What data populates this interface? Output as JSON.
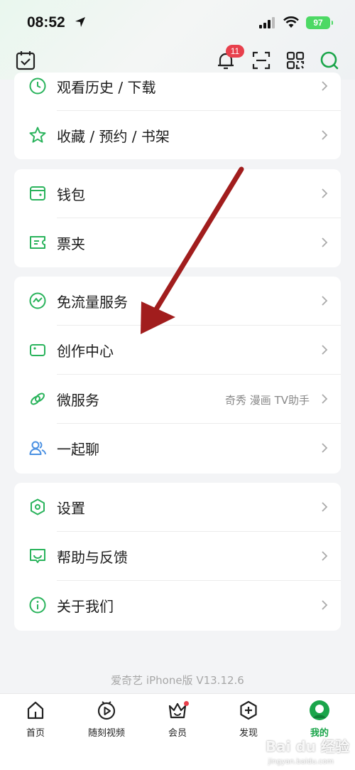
{
  "status_bar": {
    "time": "08:52",
    "battery": "97"
  },
  "header": {
    "notification_count": "11"
  },
  "group1": [
    {
      "label": "观看历史 / 下载"
    },
    {
      "label": "收藏 / 预约 / 书架"
    }
  ],
  "group2": [
    {
      "label": "钱包"
    },
    {
      "label": "票夹"
    }
  ],
  "group3": [
    {
      "label": "免流量服务"
    },
    {
      "label": "创作中心"
    },
    {
      "label": "微服务",
      "extra": "奇秀 漫画 TV助手"
    },
    {
      "label": "一起聊"
    }
  ],
  "group4": [
    {
      "label": "设置"
    },
    {
      "label": "帮助与反馈"
    },
    {
      "label": "关于我们"
    }
  ],
  "footer": {
    "version": "爱奇艺 iPhone版 V13.12.6"
  },
  "tabbar": [
    {
      "label": "首页"
    },
    {
      "label": "随刻视频"
    },
    {
      "label": "会员"
    },
    {
      "label": "发现"
    },
    {
      "label": "我的"
    }
  ],
  "watermark": {
    "text": "Bai du 经验",
    "sub": "jingyan.baidu.com"
  },
  "colors": {
    "accent": "#1aa54a",
    "annotation_arrow": "#a11d1d",
    "badge": "#e8404c"
  }
}
